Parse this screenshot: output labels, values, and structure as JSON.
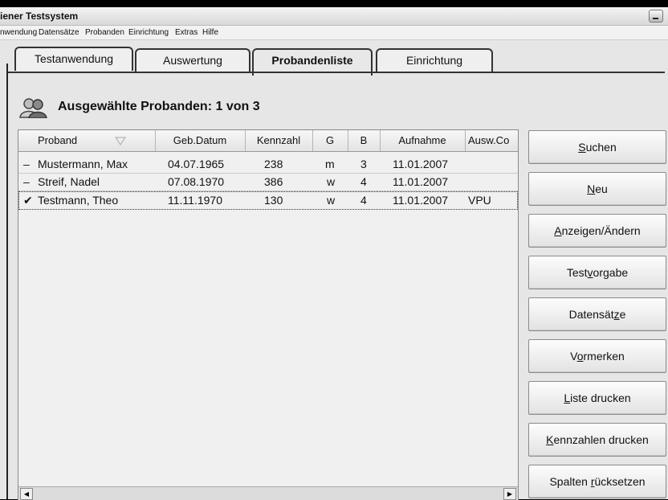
{
  "window": {
    "title": "iener Testsystem"
  },
  "menu": [
    "nwendung",
    "Datensätze",
    "Probanden",
    "Einrichtung",
    "Extras",
    "Hilfe"
  ],
  "tabs": [
    {
      "label": "Testanwendung"
    },
    {
      "label": "Auswertung"
    },
    {
      "label": "Probandenliste",
      "active": true
    },
    {
      "label": "Einrichtung"
    }
  ],
  "header": {
    "title": "Ausgewählte Probanden: 1 von 3"
  },
  "table": {
    "columns": [
      "Proband",
      "Geb.Datum",
      "Kennzahl",
      "G",
      "B",
      "Aufnahme",
      "Ausw.Co"
    ],
    "rows": [
      {
        "mark": "–",
        "name": "Mustermann, Max",
        "dob": "04.07.1965",
        "kennzahl": "238",
        "g": "m",
        "b": "3",
        "aufnahme": "11.01.2007",
        "ausw": ""
      },
      {
        "mark": "–",
        "name": "Streif, Nadel",
        "dob": "07.08.1970",
        "kennzahl": "386",
        "g": "w",
        "b": "4",
        "aufnahme": "11.01.2007",
        "ausw": ""
      },
      {
        "mark": "✔",
        "name": "Testmann, Theo",
        "dob": "11.11.1970",
        "kennzahl": "130",
        "g": "w",
        "b": "4",
        "aufnahme": "11.01.2007",
        "ausw": "VPU"
      }
    ]
  },
  "buttons": [
    {
      "pre": "",
      "key": "S",
      "post": "uchen"
    },
    {
      "pre": "",
      "key": "N",
      "post": "eu"
    },
    {
      "pre": "",
      "key": "A",
      "post": "nzeigen/Ändern"
    },
    {
      "pre": "Test",
      "key": "v",
      "post": "orgabe"
    },
    {
      "pre": "Datensät",
      "key": "z",
      "post": "e"
    },
    {
      "pre": "V",
      "key": "o",
      "post": "rmerken"
    },
    {
      "pre": "",
      "key": "L",
      "post": "iste drucken"
    },
    {
      "pre": "",
      "key": "K",
      "post": "ennzahlen drucken"
    },
    {
      "pre": "Spalten ",
      "key": "r",
      "post": "ücksetzen"
    }
  ],
  "icons": {
    "user_group": "users-icon",
    "sort": "sort-triangle-icon"
  }
}
